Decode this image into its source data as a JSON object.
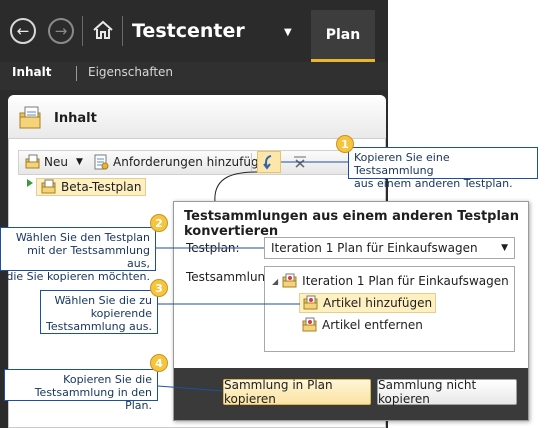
{
  "app": {
    "title": "Testcenter",
    "active_tab": "Plan",
    "subnav": {
      "tab_content": "Inhalt",
      "tab_properties": "Eigenschaften"
    },
    "panel_title": "Inhalt",
    "toolbar": {
      "new_label": "Neu",
      "add_requirements_label": "Anforderungen hinzufügen"
    },
    "tree": {
      "node_label": "Beta-Testplan"
    }
  },
  "dialog": {
    "title": "Testsammlungen aus einem anderen Testplan konvertieren",
    "testplan_label": "Testplan:",
    "testplan_value": "Iteration 1 Plan für Einkaufswagen",
    "suite_label": "Testsammlung:",
    "tree": {
      "root": "Iteration 1 Plan für Einkaufswagen",
      "children": [
        "Artikel hinzufügen",
        "Artikel entfernen"
      ]
    },
    "ok_label": "Sammlung in Plan kopieren",
    "cancel_label": "Sammlung nicht kopieren"
  },
  "callouts": [
    {
      "number": "1",
      "lines": [
        "Kopieren Sie eine Testsammlung",
        "aus einem anderen Testplan."
      ]
    },
    {
      "number": "2",
      "lines": [
        "Wählen Sie den Testplan",
        "mit der Testsammlung aus,",
        "die Sie kopieren möchten."
      ]
    },
    {
      "number": "3",
      "lines": [
        "Wählen Sie die zu",
        "kopierende",
        "Testsammlung aus."
      ]
    },
    {
      "number": "4",
      "lines": [
        "Kopieren Sie die",
        "Testsammlung in den Plan."
      ]
    }
  ],
  "colors": {
    "accent": "#e9b52c",
    "callout_border": "#1f4fa0",
    "selection": "#fff0c2",
    "chrome": "#2b2b2b"
  }
}
